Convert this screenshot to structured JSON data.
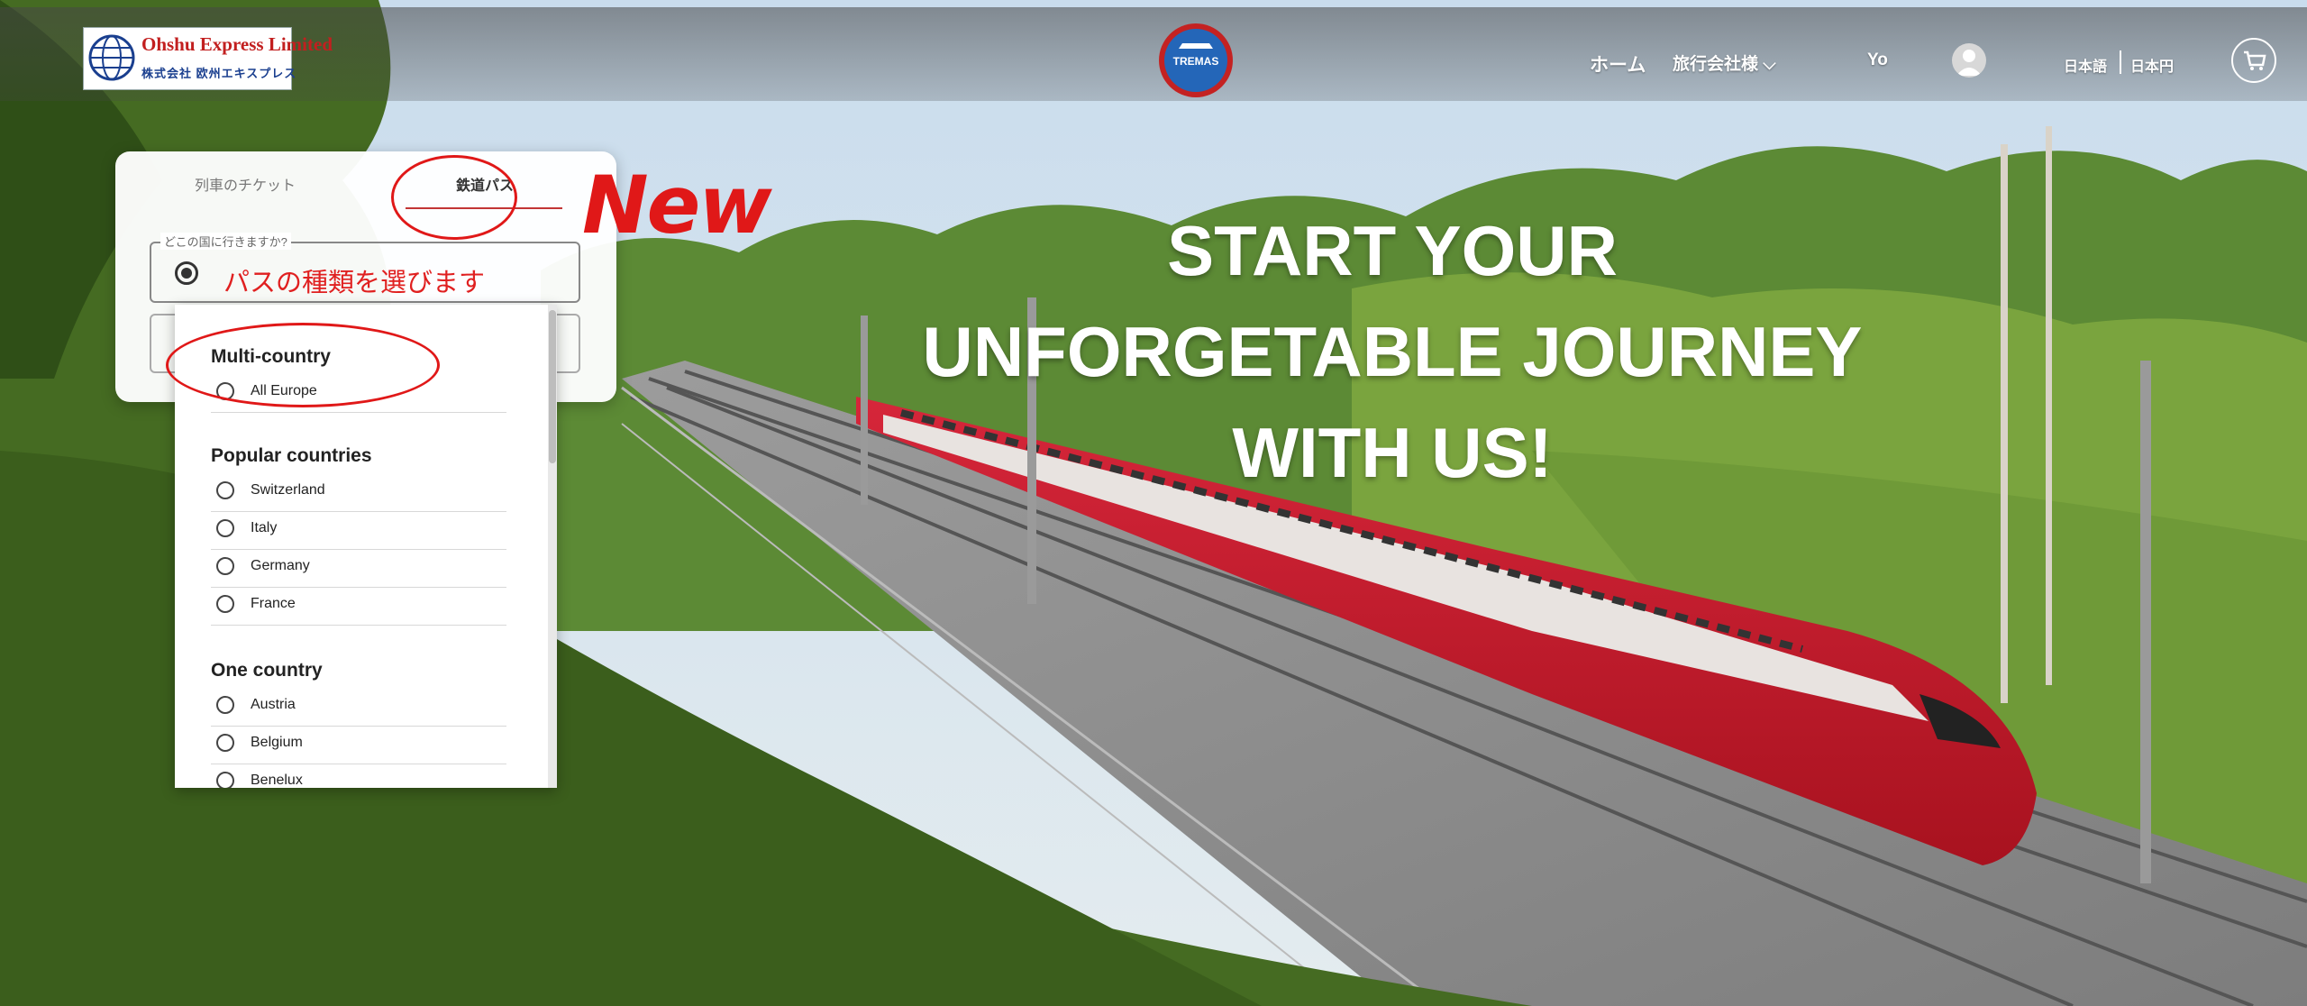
{
  "header": {
    "logo_en": "Ohshu Express Limited",
    "logo_jp": "株式会社 欧州エキスプレス",
    "emblem_text": "TREMAS",
    "nav": {
      "home": "ホーム",
      "agency": "旅行会社様 ⌵",
      "user": "Yo",
      "language": "日本語",
      "currency": "日本円"
    }
  },
  "hero": {
    "line1": "START YOUR",
    "line2": "UNFORGETABLE JOURNEY",
    "line3": "WITH US!"
  },
  "search_card": {
    "tabs": [
      {
        "label": "列車のチケット",
        "active": false
      },
      {
        "label": "鉄道パス",
        "active": true
      }
    ],
    "field_legend": "どこの国に行きますか?",
    "field_value": "パスの種類を選びます"
  },
  "dropdown": {
    "groups": [
      {
        "title": "Multi-country",
        "options": [
          "All Europe"
        ]
      },
      {
        "title": "Popular countries",
        "options": [
          "Switzerland",
          "Italy",
          "Germany",
          "France"
        ]
      },
      {
        "title": "One country",
        "options": [
          "Austria",
          "Belgium",
          "Benelux"
        ]
      }
    ]
  },
  "annotation": {
    "new_label": "New"
  },
  "colors": {
    "accent_red": "#e01818",
    "text_dark": "#222222"
  }
}
